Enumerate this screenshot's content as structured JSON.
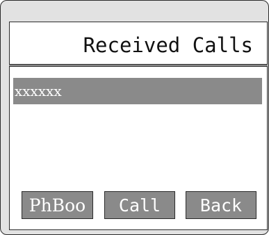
{
  "screen": {
    "title": "Received Calls"
  },
  "calls": [
    {
      "name": "xxxxxx",
      "selected": true
    }
  ],
  "softkeys": {
    "left": "PhBoo",
    "middle": "Call",
    "right": "Back"
  },
  "colors": {
    "device_bg": "#e2e2e2",
    "screen_bg": "#ffffff",
    "highlight": "#8a8a8a",
    "text_light": "#ffffff",
    "text_dark": "#111111"
  }
}
